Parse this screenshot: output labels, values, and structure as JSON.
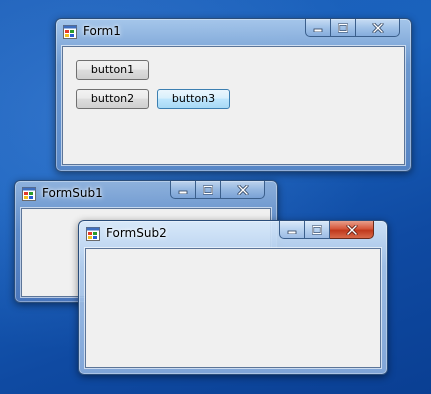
{
  "windows": {
    "form1": {
      "title": "Form1",
      "buttons": {
        "button1": "button1",
        "button2": "button2",
        "button3": "button3"
      }
    },
    "formsub1": {
      "title": "FormSub1"
    },
    "formsub2": {
      "title": "FormSub2"
    }
  },
  "colors": {
    "desktop": "#1a62bd",
    "client": "#f0f0f0",
    "close_active": "#c0391c"
  },
  "icons": {
    "app": "form-app-icon",
    "minimize": "minimize-icon",
    "maximize": "maximize-icon",
    "close": "close-icon"
  }
}
